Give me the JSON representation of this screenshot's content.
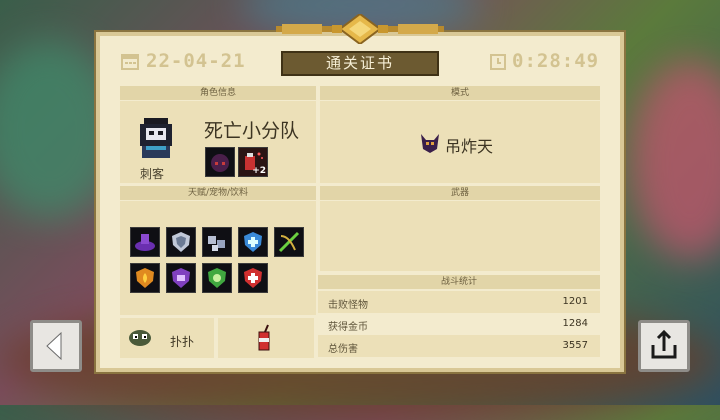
{
  "header": {
    "date": "22-04-21",
    "time": "0:28:49",
    "title": "通关证书"
  },
  "character": {
    "section_label": "角色信息",
    "class_name": "刺客",
    "team_name": "死亡小分队",
    "item_badge": "+2"
  },
  "mode": {
    "section_label": "模式",
    "name": "吊炸天"
  },
  "talents": {
    "section_label": "天赋/宠物/饮料",
    "icons": [
      "purple-cape-icon",
      "silver-shield-icon",
      "silver-ore-icon",
      "blue-shield-icon",
      "green-bow-icon",
      "fire-shield-icon",
      "purple-shield-icon",
      "green-shield-icon",
      "heal-shield-icon"
    ]
  },
  "pet": {
    "name": "扑扑"
  },
  "weapon": {
    "section_label": "武器"
  },
  "battle_stats": {
    "section_label": "战斗统计",
    "rows": [
      {
        "label": "击败怪物",
        "value": "1201"
      },
      {
        "label": "获得金币",
        "value": "1284"
      },
      {
        "label": "总伤害",
        "value": "3557"
      }
    ]
  },
  "icons": {
    "back": "back-arrow-icon",
    "share": "share-icon",
    "calendar": "calendar-icon",
    "clock": "clock-icon"
  }
}
